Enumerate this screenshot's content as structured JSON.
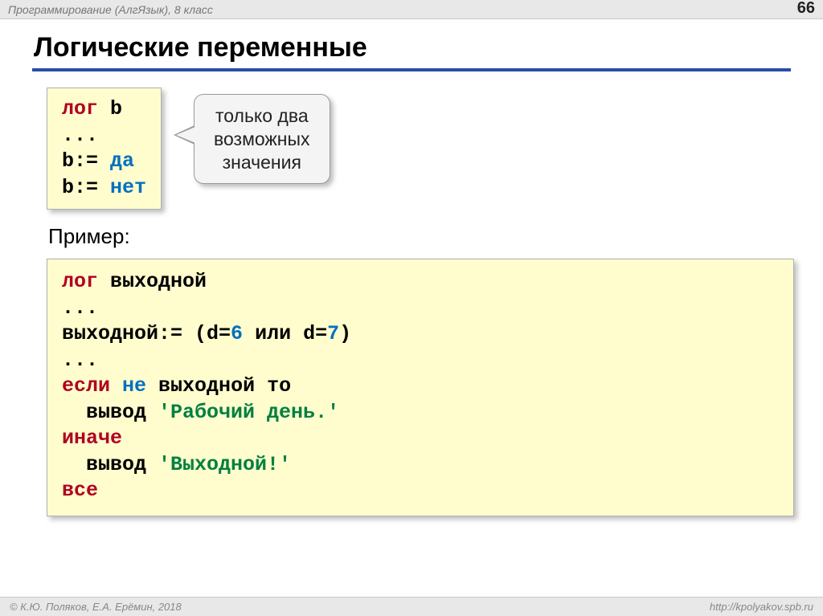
{
  "header": {
    "title": "Программирование (АлгЯзык), 8 класс",
    "page_number": "66"
  },
  "slide_title": "Логические переменные",
  "code_small": {
    "line1_kw": "лог",
    "line1_rest": " b",
    "line2": "...",
    "line3_lhs": "b:= ",
    "line3_val": "да",
    "line4_lhs": "b:= ",
    "line4_val": "нет"
  },
  "callout": {
    "line1": "только два",
    "line2": "возможных",
    "line3": "значения"
  },
  "example_label": "Пример:",
  "code_big": {
    "l1_kw": "лог",
    "l1_rest": " выходной",
    "l2": "...",
    "l3_a": "выходной:= (d=",
    "l3_n1": "6",
    "l3_b": " или d=",
    "l3_n2": "7",
    "l3_c": ")",
    "l4": "...",
    "l5_kw": "если",
    "l5_sp1": " ",
    "l5_ne": "не",
    "l5_rest": " выходной то",
    "l6_a": "  вывод ",
    "l6_str": "'Рабочий день.'",
    "l7_kw": "иначе",
    "l8_a": "  вывод ",
    "l8_str": "'Выходной!'",
    "l9_kw": "все"
  },
  "footer": {
    "left": "© К.Ю. Поляков, Е.А. Ерёмин, 2018",
    "right": "http://kpolyakov.spb.ru"
  }
}
